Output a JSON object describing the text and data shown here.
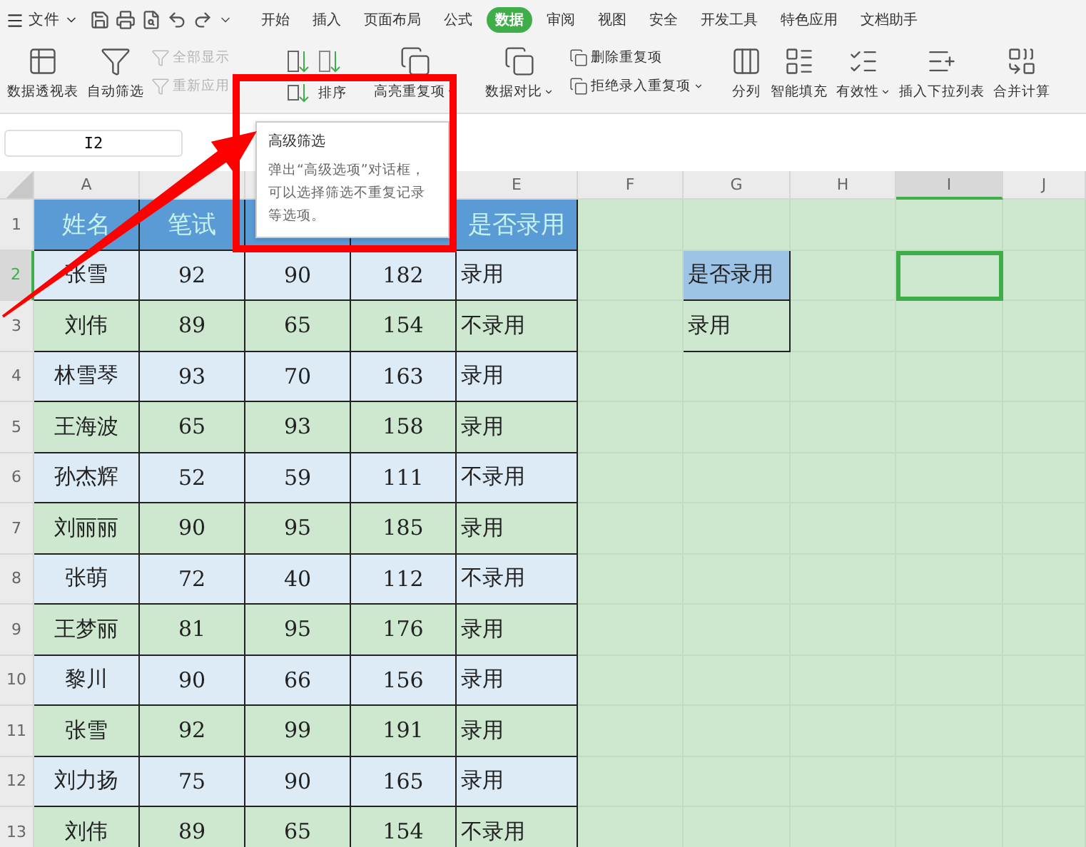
{
  "menu": {
    "label": "文件"
  },
  "ribbon_tabs": [
    {
      "label": "开始",
      "selected": false
    },
    {
      "label": "插入",
      "selected": false
    },
    {
      "label": "页面布局",
      "selected": false
    },
    {
      "label": "公式",
      "selected": false
    },
    {
      "label": "数据",
      "selected": true
    },
    {
      "label": "审阅",
      "selected": false
    },
    {
      "label": "视图",
      "selected": false
    },
    {
      "label": "安全",
      "selected": false
    },
    {
      "label": "开发工具",
      "selected": false
    },
    {
      "label": "特色应用",
      "selected": false
    },
    {
      "label": "文档助手",
      "selected": false
    }
  ],
  "tools": [
    {
      "kind": "large",
      "label": "数据透视表"
    },
    {
      "kind": "large",
      "label": "自动筛选"
    },
    {
      "kind": "stack",
      "items": [
        {
          "label": "全部显示",
          "disabled": true
        },
        {
          "label": "重新应用",
          "disabled": true
        }
      ]
    },
    {
      "kind": "sort",
      "label": "排序"
    },
    {
      "kind": "large",
      "label": "高亮重复项",
      "dropdown": true
    },
    {
      "kind": "large",
      "label": "数据对比",
      "dropdown": true
    },
    {
      "kind": "stack",
      "items": [
        {
          "label": "删除重复项",
          "disabled": false
        },
        {
          "label": "拒绝录入重复项",
          "disabled": false,
          "dropdown": true
        }
      ]
    },
    {
      "kind": "large",
      "label": "分列"
    },
    {
      "kind": "large",
      "label": "智能填充"
    },
    {
      "kind": "large",
      "label": "有效性",
      "dropdown": true
    },
    {
      "kind": "large",
      "label": "插入下拉列表"
    },
    {
      "kind": "large",
      "label": "合并计算"
    }
  ],
  "name_box": "I2",
  "tooltip": {
    "title": "高级筛选",
    "text": "弹出“高级选项”对话框，可以选择筛选不重复记录等选项。"
  },
  "columns": [
    {
      "label": "A",
      "selected": false
    },
    {
      "selected": false
    },
    {
      "selected": false
    },
    {
      "selected": false
    },
    {
      "label": "E",
      "selected": false
    },
    {
      "label": "F",
      "selected": false
    },
    {
      "label": "G",
      "selected": false
    },
    {
      "label": "H",
      "selected": false
    },
    {
      "label": "I",
      "selected": true
    },
    {
      "label": "J",
      "selected": false
    }
  ],
  "row_numbers": [
    {
      "label": "1",
      "selected": false
    },
    {
      "label": "2",
      "selected": true
    },
    {
      "label": "3",
      "selected": false
    },
    {
      "label": "4",
      "selected": false
    },
    {
      "label": "5",
      "selected": false
    },
    {
      "label": "6",
      "selected": false
    },
    {
      "label": "7",
      "selected": false
    },
    {
      "label": "8",
      "selected": false
    },
    {
      "label": "9",
      "selected": false
    },
    {
      "label": "10",
      "selected": false
    },
    {
      "label": "11",
      "selected": false
    },
    {
      "label": "12",
      "selected": false
    },
    {
      "label": "13",
      "selected": false
    }
  ],
  "table": {
    "headers_left": [
      "姓名",
      "笔试"
    ],
    "headers_right": [
      "是否录用"
    ],
    "rows": [
      [
        "张雪",
        "92",
        "90",
        "182",
        "录用"
      ],
      [
        "刘伟",
        "89",
        "65",
        "154",
        "不录用"
      ],
      [
        "林雪琴",
        "93",
        "70",
        "163",
        "录用"
      ],
      [
        "王海波",
        "65",
        "93",
        "158",
        "录用"
      ],
      [
        "孙杰辉",
        "52",
        "59",
        "111",
        "不录用"
      ],
      [
        "刘丽丽",
        "90",
        "95",
        "185",
        "录用"
      ],
      [
        "张萌",
        "72",
        "40",
        "112",
        "不录用"
      ],
      [
        "王梦丽",
        "81",
        "95",
        "176",
        "录用"
      ],
      [
        "黎川",
        "90",
        "66",
        "156",
        "录用"
      ],
      [
        "张雪",
        "92",
        "99",
        "191",
        "录用"
      ],
      [
        "刘力扬",
        "75",
        "90",
        "165",
        "录用"
      ],
      [
        "刘伟",
        "89",
        "65",
        "154",
        "不录用"
      ]
    ]
  },
  "criteria": {
    "header": "是否录用",
    "value": "录用"
  }
}
